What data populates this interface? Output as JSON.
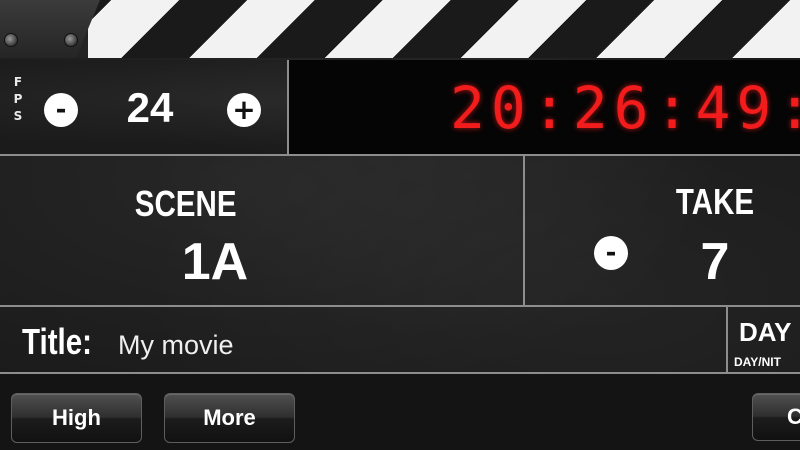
{
  "clapper": {
    "label": ""
  },
  "fps": {
    "letters": [
      "F",
      "P",
      "S"
    ],
    "decrement_symbol": "-",
    "increment_symbol": "+",
    "value": "24"
  },
  "timecode": {
    "display": "20:26:49:",
    "color": "#f21c1c"
  },
  "scene": {
    "label": "SCENE",
    "value": "1A"
  },
  "take": {
    "label": "TAKE",
    "decrement_symbol": "-",
    "value": "7"
  },
  "title": {
    "label": "Title:",
    "value": "My movie"
  },
  "day_night": {
    "value": "DAY",
    "label": "DAY/NIT"
  },
  "buttons": {
    "high": "High",
    "more": "More",
    "right_partial": "C"
  }
}
